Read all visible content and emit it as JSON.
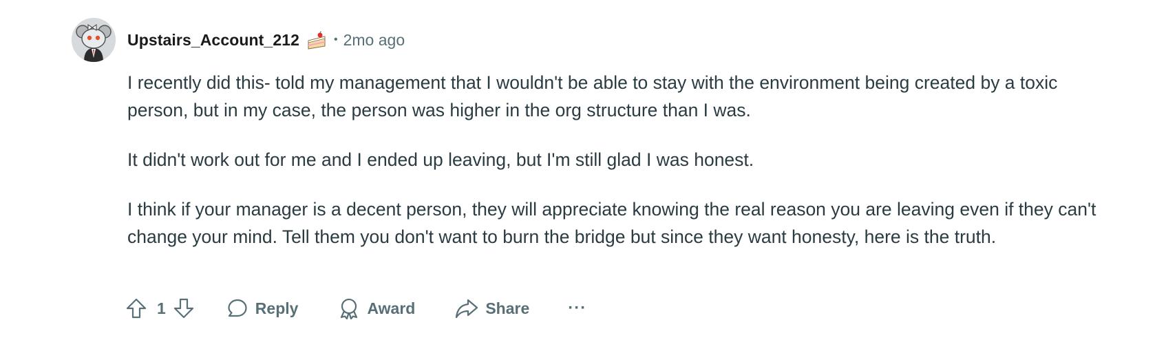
{
  "comment": {
    "username": "Upstairs_Account_212",
    "badge_icon": "cake-day-icon",
    "separator": "•",
    "timestamp": "2mo ago",
    "paragraphs": [
      "I recently did this- told my management that I wouldn't be able to stay with the environment being created by a toxic person, but in my case, the person was higher in the org structure than I was.",
      "It didn't work out for me and I ended up leaving, but I'm still glad I was honest.",
      "I think if your manager is a decent person, they will appreciate knowing the real reason you are leaving even if they can't change your mind. Tell them you don't want to burn the bridge but since they want honesty, here is the truth."
    ]
  },
  "actions": {
    "vote_count": "1",
    "reply_label": "Reply",
    "award_label": "Award",
    "share_label": "Share",
    "more_label": "···"
  },
  "colors": {
    "text": "#2a3c42",
    "muted": "#576f76",
    "username": "#1a1a1b"
  }
}
